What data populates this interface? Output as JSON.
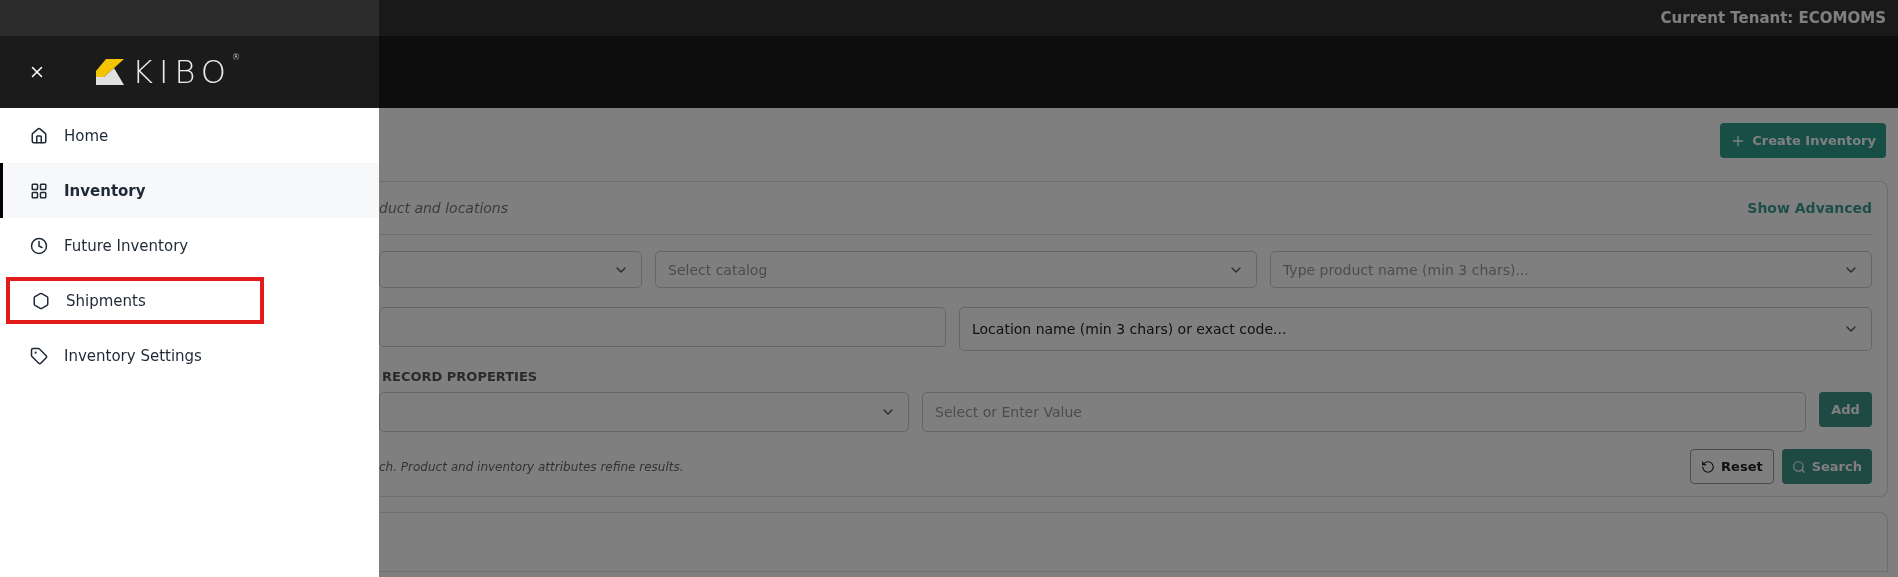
{
  "top_bar": {
    "tenant": "Current Tenant: ECOMOMS"
  },
  "sidebar": {
    "logo": "KIBO$^{®}$",
    "items": [
      {
        "label": "Home",
        "selected": false,
        "highlighted": false
      },
      {
        "label": "Inventory",
        "selected": true,
        "highlighted": false
      },
      {
        "label": "Future Inventory",
        "selected": false,
        "highlighted": false
      },
      {
        "label": "Shipments",
        "selected": false,
        "highlighted": true
      },
      {
        "label": "Inventory Settings",
        "selected": false,
        "highlighted": false
      }
    ]
  },
  "create_button": "Create Inventory",
  "search_card": {
    "subtitle": "duct and locations",
    "toggle": "Show Advanced",
    "fields_row_1": [
      {
        "kind": "select"
      },
      {
        "kind": "select",
        "placeholder": "Select catalog"
      },
      {
        "kind": "select",
        "placeholder": "Type product name (min 3 chars)..."
      }
    ],
    "fields_row_2": [
      {
        "kind": "input"
      },
      {
        "kind": "select",
        "value": "Location name (min 3 chars) or exact code..."
      }
    ],
    "section_label": "RECORD PROPERTIES",
    "property_field": {
      "kind": "select"
    },
    "value_field": {
      "placeholder": "Select or Enter Value"
    },
    "add_button": {
      "label": "Add",
      "disabled": true
    },
    "hint": "ch. Product and inventory attributes refine results.",
    "reset_button": {
      "label": "Reset",
      "disabled": false
    },
    "search_button": {
      "label": "Search",
      "disabled": true
    }
  }
}
